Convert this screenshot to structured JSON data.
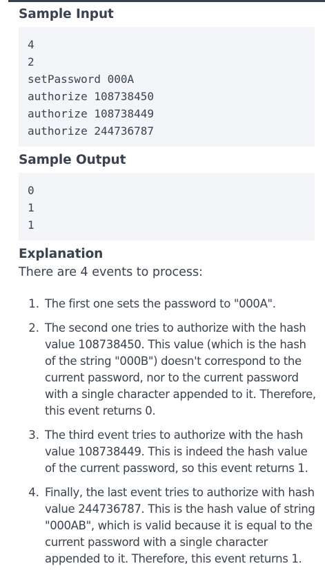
{
  "sample_input": {
    "heading": "Sample Input",
    "lines": [
      "4",
      "2",
      "setPassword 000A",
      "authorize 108738450",
      "authorize 108738449",
      "authorize 244736787"
    ]
  },
  "sample_output": {
    "heading": "Sample Output",
    "lines": [
      "0",
      "1",
      "1"
    ]
  },
  "explanation": {
    "heading": "Explanation",
    "intro": "There are 4 events to process:",
    "events": [
      {
        "number": "1.",
        "text": "The first one sets the password to \"000A\"."
      },
      {
        "number": "2.",
        "text": "The second one tries to authorize with the hash value 108738450. This value (which is the hash of the string \"000B\") doesn't correspond to the current password, nor to the current password with a single character appended to it. Therefore, this event returns 0."
      },
      {
        "number": "3.",
        "text": "The third event tries to authorize with the hash value 108738449. This is indeed the hash value of the current password, so this event returns 1."
      },
      {
        "number": "4.",
        "text": "Finally, the last event tries to authorize with hash value 244736787. This is the hash value of string \"000AB\", which is valid because it is equal to the current password with a single character appended to it. Therefore, this event returns 1."
      }
    ]
  }
}
